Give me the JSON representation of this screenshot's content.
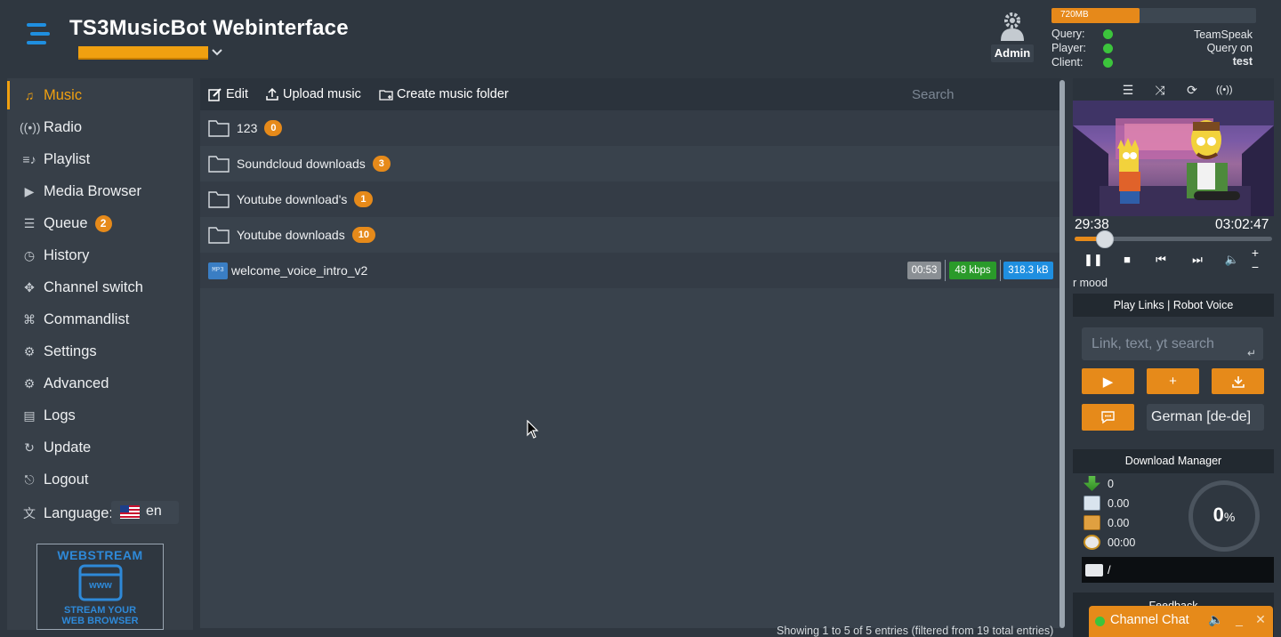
{
  "header": {
    "app_title": "TS3MusicBot Webinterface",
    "admin_label": "Admin",
    "memory": {
      "label": "720MB",
      "fill_fraction": 0.43
    },
    "status": [
      {
        "label": "Query:",
        "state": "ok"
      },
      {
        "label": "Player:",
        "state": "ok"
      },
      {
        "label": "Client:",
        "state": "ok"
      }
    ],
    "server_lines": [
      "TeamSpeak",
      "Query on",
      "test"
    ],
    "colors": {
      "accent": "#e68a1a",
      "status_ok": "#3cc43c",
      "brand_blue": "#1f8fe0"
    }
  },
  "sidebar": {
    "items": [
      {
        "label": "Music",
        "icon": "music-note-icon",
        "active": true
      },
      {
        "label": "Radio",
        "icon": "radio-waves-icon"
      },
      {
        "label": "Playlist",
        "icon": "playlist-icon"
      },
      {
        "label": "Media Browser",
        "icon": "video-icon"
      },
      {
        "label": "Queue",
        "icon": "list-icon",
        "badge": "2"
      },
      {
        "label": "History",
        "icon": "clock-icon"
      },
      {
        "label": "Channel switch",
        "icon": "move-arrows-icon"
      },
      {
        "label": "Commandlist",
        "icon": "command-icon"
      },
      {
        "label": "Settings",
        "icon": "gear-icon"
      },
      {
        "label": "Advanced",
        "icon": "cog-outline-icon"
      },
      {
        "label": "Logs",
        "icon": "document-icon"
      },
      {
        "label": "Update",
        "icon": "refresh-icon"
      },
      {
        "label": "Logout",
        "icon": "exit-door-icon"
      }
    ],
    "language_label": "Language:",
    "language_code": "en",
    "promo": {
      "title": "WEBSTREAM",
      "line1": "STREAM YOUR",
      "line2": "WEB BROWSER",
      "icon_text": "www"
    }
  },
  "toolbar": {
    "edit_label": "Edit",
    "upload_label": "Upload music",
    "create_folder_label": "Create music folder",
    "search_placeholder": "Search"
  },
  "files": {
    "folders": [
      {
        "name": "123",
        "count": "0"
      },
      {
        "name": "Soundcloud downloads",
        "count": "3"
      },
      {
        "name": "Youtube download's",
        "count": "1"
      },
      {
        "name": "Youtube downloads",
        "count": "10"
      }
    ],
    "tracks": [
      {
        "type": "MP3",
        "name": "welcome_voice_intro_v2",
        "duration": "00:53",
        "bitrate": "48 kbps",
        "size": "318.3 kB"
      }
    ],
    "footer": "Showing 1 to 5 of 5 entries (filtered from 19 total entries)"
  },
  "player": {
    "elapsed": "29:38",
    "total": "03:02:47",
    "progress_fraction": 0.16,
    "mood_text": "r mood",
    "play_links_label": "Play Links | Robot Voice",
    "link_placeholder": "Link, text, yt search",
    "voice_value": "German [de-de]"
  },
  "download_manager": {
    "title": "Download Manager",
    "rows": [
      {
        "icon": "download-arrow-icon",
        "value": "0"
      },
      {
        "icon": "activity-chart-icon",
        "value": "0.00"
      },
      {
        "icon": "package-box-icon",
        "value": "0.00"
      },
      {
        "icon": "stopwatch-icon",
        "value": "00:00"
      }
    ],
    "percent": "0",
    "percent_unit": "%",
    "path": "/",
    "feedback_label": "Feedback"
  },
  "chat": {
    "title": "Channel Chat"
  }
}
